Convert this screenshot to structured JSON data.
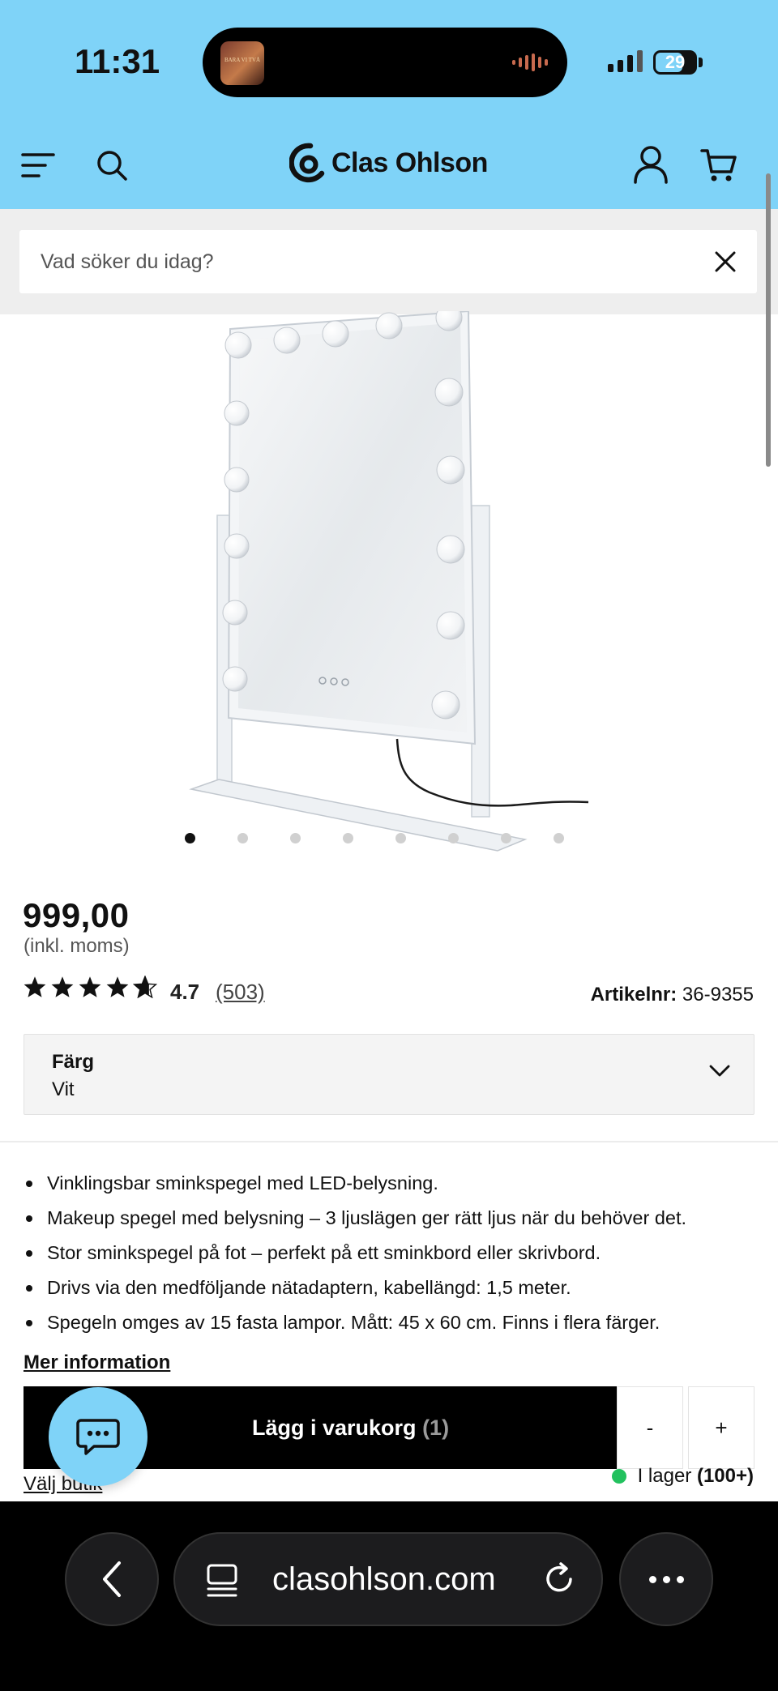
{
  "status_bar": {
    "time": "11:31",
    "battery": "29",
    "island_thumb_text": "BARA VI TVÅ"
  },
  "header": {
    "logo_text": "Clas Ohlson",
    "icons": [
      "menu-icon",
      "search-icon",
      "account-icon",
      "cart-icon"
    ]
  },
  "search": {
    "placeholder": "Vad söker du idag?",
    "value": ""
  },
  "gallery": {
    "dot_count": 8,
    "active_index": 0
  },
  "product": {
    "price": "999,00",
    "vat_note": "(inkl. moms)",
    "rating": "4.7",
    "rating_count": "(503)",
    "rating_value": 4.7,
    "article_label": "Artikelnr:",
    "article_number": "36-9355"
  },
  "variant": {
    "label": "Färg",
    "value": "Vit"
  },
  "bullets": [
    "Vinklingsbar sminkspegel med LED-belysning.",
    "Makeup spegel med belysning – 3 ljuslägen ger rätt ljus när du behöver det.",
    "Stor sminkspegel på fot – perfekt på ett sminkbord eller skrivbord.",
    "Drivs via den medföljande nätadaptern, kabellängd: 1,5 meter.",
    "Spegeln omges av 15 fasta lampor. Mått: 45 x 60 cm. Finns i flera färger."
  ],
  "more_info": "Mer information",
  "cart": {
    "add_label": "Lägg i varukorg",
    "add_qty": "(1)",
    "minus": "-",
    "plus": "+"
  },
  "store": {
    "select_store": "Välj butik",
    "stock_text": "I lager",
    "stock_count": "(100+)",
    "stock_color": "#22c15e"
  },
  "browser": {
    "url": "clasohlson.com"
  },
  "colors": {
    "brand_bg": "#7fd3f8",
    "button_bg": "#000000"
  }
}
